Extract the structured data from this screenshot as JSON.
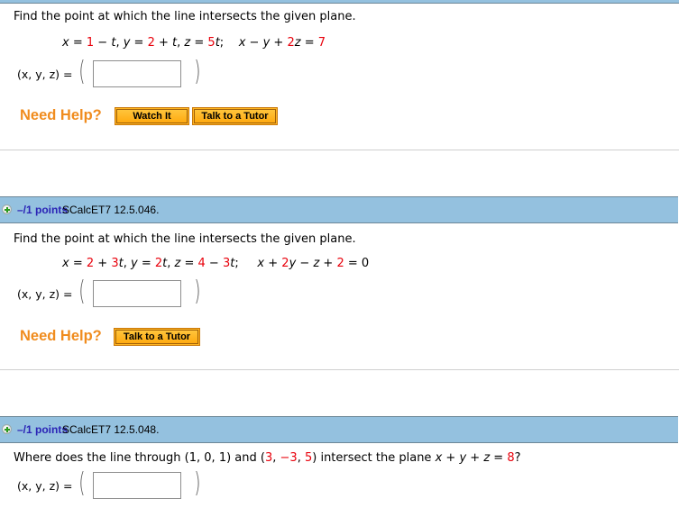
{
  "q1": {
    "prompt": "Find the point at which the line intersects the given plane.",
    "eq": {
      "x_var": "x",
      "eq1": " = ",
      "x_c": "1",
      "x_op": " − ",
      "t1": "t",
      "c1": ",  ",
      "y_var": "y",
      "eq2": " = ",
      "y_c": "2",
      "y_op": " + ",
      "t2": "t",
      "c2": ",  ",
      "z_var": "z",
      "eq3": " = ",
      "z_c": "5",
      "t3": "t",
      "semi": ";",
      "p_x": "x",
      "p_op1": " − ",
      "p_y": "y",
      "p_op2": " + ",
      "p_zc": "2",
      "p_z": "z",
      "p_eq": " = ",
      "p_rhs": "7"
    },
    "answer_label": "(x, y, z)  =",
    "answer_value": "",
    "need_help": "Need Help?",
    "buttons": [
      "Watch It",
      "Talk to a Tutor"
    ]
  },
  "q2": {
    "header": {
      "points": "–/1 points",
      "source": "SCalcET7 12.5.046."
    },
    "prompt": "Find the point at which the line intersects the given plane.",
    "eq": {
      "x_var": "x",
      "eq1": " = ",
      "x_c": "2",
      "x_op": " + ",
      "x_k": "3",
      "t1": "t",
      "c1": ",  ",
      "y_var": "y",
      "eq2": " = ",
      "y_k": "2",
      "t2": "t",
      "c2": ",  ",
      "z_var": "z",
      "eq3": " = ",
      "z_c": "4",
      "z_op": " − ",
      "z_k": "3",
      "t3": "t",
      "semi": ";",
      "p_x": "x",
      "p_op1": " + ",
      "p_yc": "2",
      "p_y": "y",
      "p_op2": " − ",
      "p_z": "z",
      "p_op3": " + ",
      "p_c": "2",
      "p_eq": " = ",
      "p_rhs": "0"
    },
    "answer_label": "(x, y, z)  =",
    "answer_value": "",
    "need_help": "Need Help?",
    "buttons": [
      "Talk to a Tutor"
    ]
  },
  "q3": {
    "header": {
      "points": "–/1 points",
      "source": "SCalcET7 12.5.048."
    },
    "prompt_a": "Where does the line through  ",
    "point1": "(1, 0, 1)",
    "and": " and ",
    "p2_open": "(",
    "p2_a": "3",
    "p2_sep1": ", ",
    "p2_b": "−3",
    "p2_sep2": ", ",
    "p2_c": "5",
    "p2_close": ")",
    "prompt_b": "  intersect the plane  ",
    "plane_x": "x",
    "plane_op1": " + ",
    "plane_y": "y",
    "plane_op2": " + ",
    "plane_z": "z",
    "plane_eq": " = ",
    "plane_rhs": "8",
    "qmark": "?",
    "answer_label": "(x, y, z)  =",
    "answer_value": ""
  },
  "colors": {
    "header_band": "#94c1df",
    "points_text": "#2b24b6",
    "need_help": "#f08c1e",
    "highlight": "#e8000b",
    "button": "#ffb520"
  }
}
